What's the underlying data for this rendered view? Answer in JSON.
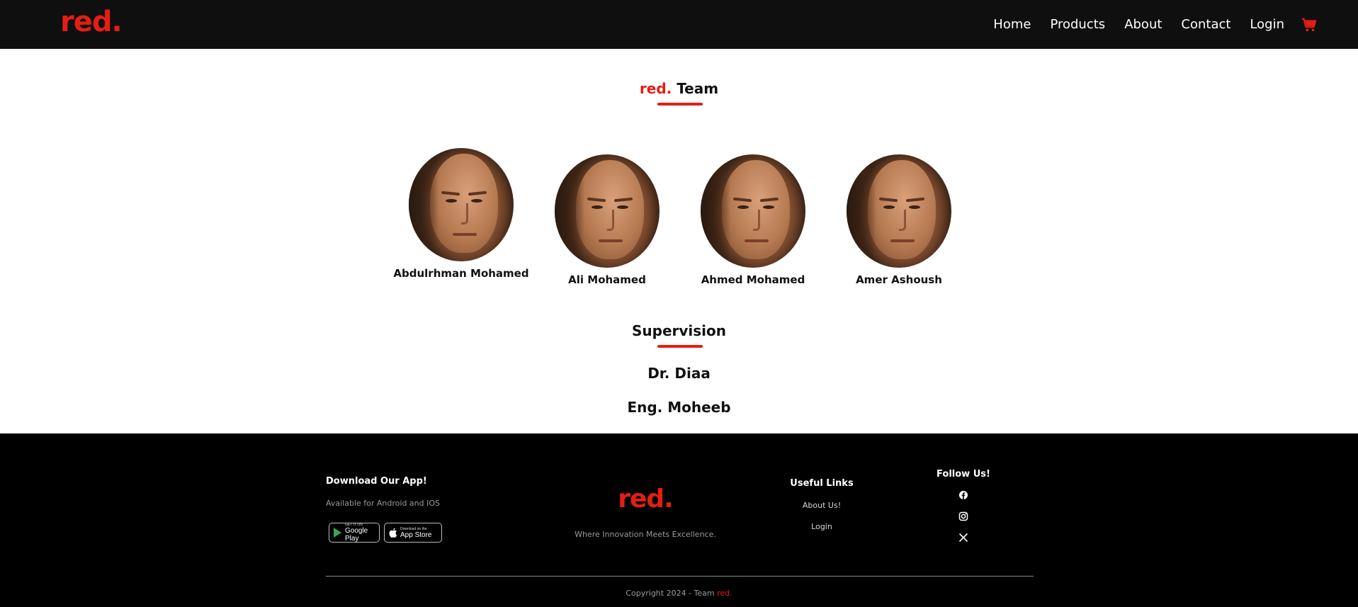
{
  "navbar": {
    "brand": "red.",
    "links": [
      "Home",
      "Products",
      "About",
      "Contact",
      "Login"
    ],
    "cart_icon": "shopping-cart-icon",
    "accent_color": "#e41e14"
  },
  "team": {
    "title_brand": "red.",
    "title_rest": " Team",
    "members": [
      {
        "name": "Abdulrhman Mohamed"
      },
      {
        "name": "Ali Mohamed"
      },
      {
        "name": "Ahmed Mohamed"
      },
      {
        "name": "Amer Ashoush"
      }
    ]
  },
  "supervision": {
    "title": "Supervision",
    "names": [
      "Dr. Diaa",
      "Eng. Moheeb"
    ]
  },
  "footer": {
    "app_title": "Download Our App!",
    "app_subtitle": "Available for Android and IOS",
    "google_play": {
      "small": "GET IT ON",
      "big": "Google Play"
    },
    "app_store": {
      "small": "Download on the",
      "big": "App Store"
    },
    "brand": "red.",
    "tagline": "Where Innovation Meets Excellence.",
    "useful_links_title": "Useful Links",
    "useful_links": [
      "About Us!",
      "Login"
    ],
    "follow_title": "Follow Us!",
    "social_icons": [
      "facebook-icon",
      "instagram-icon",
      "x-twitter-icon"
    ],
    "copyright_text": "Copyright 2024 - Team ",
    "copyright_brand": "red."
  }
}
